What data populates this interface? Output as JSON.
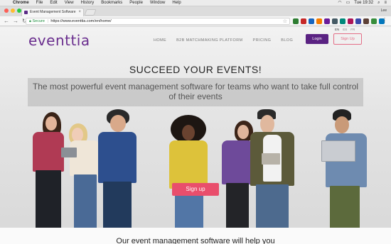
{
  "menubar": {
    "app": "Chrome",
    "items": [
      "File",
      "Edit",
      "View",
      "History",
      "Bookmarks",
      "People",
      "Window",
      "Help"
    ],
    "clock": "Tue 19:32"
  },
  "browser": {
    "tab_title": "Event Management Software",
    "profile": "Lee",
    "secure_label": "Secure",
    "url": "https://www.eventtia.com/en/home/"
  },
  "site": {
    "logo": "eventtia",
    "nav": [
      "HOME",
      "B2B MATCHMAKING PLATFORM",
      "PRICING",
      "BLOG"
    ],
    "login": "Login",
    "signup_top": "Sign Up",
    "languages": [
      "EN",
      "ES",
      "FR"
    ],
    "headline": "SUCCEED YOUR EVENTS!",
    "subtitle": "The most powerful event management software for teams who want to take full control of their events",
    "signup_hero": "Sign up",
    "bottom_text": "Our event management software will help you"
  },
  "colors": {
    "brand": "#6a2e8e",
    "login_bg": "#5a2282",
    "accent_pink": "#e94e6c"
  }
}
